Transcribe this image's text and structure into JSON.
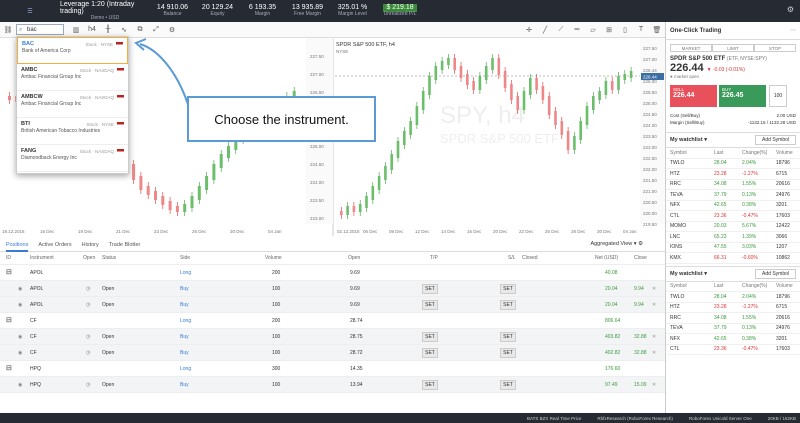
{
  "topbar": {
    "stats": [
      {
        "value": "Leverage 1:20 (Intraday trading)",
        "label": "Demo • USD"
      },
      {
        "value": "14 910.06",
        "label": "Balance"
      },
      {
        "value": "20 129.24",
        "label": "Equity"
      },
      {
        "value": "6 193.35",
        "label": "Margin"
      },
      {
        "value": "13 935.89",
        "label": "Free Margin"
      },
      {
        "value": "325.01 %",
        "label": "Margin Level"
      },
      {
        "value": "$ 219.18",
        "label": "Unrealized P/L"
      }
    ]
  },
  "search": {
    "value": "bac"
  },
  "dropdown": [
    {
      "symbol": "BAC",
      "name": "Bank of America Corp",
      "type": "Stock · NYSE"
    },
    {
      "symbol": "AMBC",
      "name": "Ambac Financial Group Inc",
      "type": "Stock · NASDAQ"
    },
    {
      "symbol": "AMBCW",
      "name": "Ambac Financial Group Inc",
      "type": "Stock · NASDAQ"
    },
    {
      "symbol": "BTI",
      "name": "British American Tobacco Industries",
      "type": "Stock · NYSE"
    },
    {
      "symbol": "FANG",
      "name": "Diamondback Energy Inc",
      "type": "Stock · NASDAQ"
    }
  ],
  "callout": {
    "text": "Choose the instrument."
  },
  "chart": {
    "left_dates": [
      "19.12.2016",
      "16 Dec",
      "19 Dec",
      "21 Dec",
      "23 Dec",
      "26 Dec",
      "30 Dec",
      "04 Jan"
    ],
    "left_prices": [
      "227.50",
      "227.00",
      "226.50",
      "226.00",
      "225.50",
      "225.00",
      "224.50",
      "224.00",
      "223.50",
      "223.00"
    ],
    "right_title": "SPDR S&P 500 ETF, h4",
    "right_sub": "NYSE",
    "right_watermark": "SPY, h4",
    "right_watermark2": "SPDR S&P 500 ETF",
    "right_dates": [
      "02.12.2016",
      "06 Dec",
      "08 Dec",
      "12 Dec",
      "14 Dec",
      "16 Dec",
      "20 Dec",
      "22 Dec",
      "26 Dec",
      "28 Dec",
      "30 Dec",
      "04 Jan"
    ],
    "right_prices": [
      "227.50",
      "227.00",
      "226.44",
      "226.00",
      "225.50",
      "225.00",
      "224.50",
      "224.00",
      "223.50",
      "223.00",
      "222.50",
      "222.00",
      "221.50",
      "221.00",
      "220.50",
      "220.00",
      "219.50"
    ],
    "current_price": "226.44"
  },
  "tabs": [
    "Positions",
    "Active Orders",
    "History",
    "Trade Blotter"
  ],
  "aggregated": "Aggregated View",
  "table": {
    "headers": [
      "ID",
      "Instrument",
      "Open",
      "Status",
      "Side",
      "Volume",
      "Open",
      "T/P",
      "S/L",
      "Closed",
      "Net (USD)",
      "Close"
    ],
    "rows": [
      {
        "kind": "parent",
        "instrument": "APOL",
        "status": "",
        "side": "Long",
        "volume": "200",
        "open": "9.69",
        "tp": "",
        "sl": "",
        "net": "40.08",
        "close": ""
      },
      {
        "kind": "child",
        "instrument": "APOL",
        "status": "Open",
        "side": "Buy",
        "volume": "100",
        "open": "9.69",
        "tp": "SET",
        "sl": "SET",
        "net": "20.04",
        "close": "9.94"
      },
      {
        "kind": "child",
        "instrument": "APOL",
        "status": "Open",
        "side": "Buy",
        "volume": "100",
        "open": "9.69",
        "tp": "SET",
        "sl": "SET",
        "net": "20.04",
        "close": "9.94"
      },
      {
        "kind": "parent",
        "instrument": "CF",
        "status": "",
        "side": "Long",
        "volume": "200",
        "open": "28.74",
        "tp": "",
        "sl": "",
        "net": "806.64",
        "close": ""
      },
      {
        "kind": "child",
        "instrument": "CF",
        "status": "Open",
        "side": "Buy",
        "volume": "100",
        "open": "28.75",
        "tp": "SET",
        "sl": "SET",
        "net": "403.82",
        "close": "32.88"
      },
      {
        "kind": "child",
        "instrument": "CF",
        "status": "Open",
        "side": "Buy",
        "volume": "100",
        "open": "28.72",
        "tp": "SET",
        "sl": "SET",
        "net": "402.82",
        "close": "32.88"
      },
      {
        "kind": "parent",
        "instrument": "HPQ",
        "status": "",
        "side": "Long",
        "volume": "300",
        "open": "14.35",
        "tp": "",
        "sl": "",
        "net": "176.60",
        "close": ""
      },
      {
        "kind": "child",
        "instrument": "HPQ",
        "status": "Open",
        "side": "Buy",
        "volume": "100",
        "open": "13.94",
        "tp": "SET",
        "sl": "SET",
        "net": "97.49",
        "close": "15.09"
      }
    ]
  },
  "right": {
    "title": "One-Click Trading",
    "order_tabs": [
      "MARKET",
      "LIMIT",
      "STOP"
    ],
    "symbol": "SPDR S&P 500 ETF",
    "symbol_meta": "(ETF, NYSE:SPY)",
    "price": "226.44",
    "price_change": "▼ -0.03 (-0.01%)",
    "market_status": "● market open",
    "sell_label": "SELL",
    "sell_price": "226.44",
    "buy_label": "BUY",
    "buy_price": "226.45",
    "qty": "100",
    "cost_label": "Cost (Sell/Buy)",
    "cost_value": "2.00 USD",
    "margin_label": "Margin (Sell/Buy)",
    "margin_value": "-1132.15 / 1132.28 USD",
    "watchlist_title": "My watchlist",
    "add_symbol": "Add Symbol",
    "wl_headers": [
      "Symbol",
      "Last",
      "Change(%)",
      "Volume"
    ],
    "watchlist": [
      {
        "s": "TWLO",
        "last": "28.04",
        "chg": "2.04%",
        "vol": "18796",
        "up": true
      },
      {
        "s": "HTZ",
        "last": "23.28",
        "chg": "-1.27%",
        "vol": "6715",
        "up": false
      },
      {
        "s": "RRC",
        "last": "34.08",
        "chg": "1.55%",
        "vol": "20616",
        "up": true
      },
      {
        "s": "TEVA",
        "last": "37.79",
        "chg": "0.13%",
        "vol": "24976",
        "up": true
      },
      {
        "s": "NFX",
        "last": "42.65",
        "chg": "0.38%",
        "vol": "3201",
        "up": true
      },
      {
        "s": "CTL",
        "last": "23.36",
        "chg": "-0.47%",
        "vol": "17603",
        "up": false
      },
      {
        "s": "MOMO",
        "last": "20.03",
        "chg": "5.67%",
        "vol": "12422",
        "up": true
      },
      {
        "s": "LNC",
        "last": "65.23",
        "chg": "1.39%",
        "vol": "3066",
        "up": true
      },
      {
        "s": "IONS",
        "last": "47.55",
        "chg": "3.03%",
        "vol": "1207",
        "up": true
      },
      {
        "s": "KMX",
        "last": "66.31",
        "chg": "-0.60%",
        "vol": "10862",
        "up": false
      }
    ],
    "watchlist2": [
      {
        "s": "TWLO",
        "last": "28.04",
        "chg": "2.04%",
        "vol": "18796",
        "up": true
      },
      {
        "s": "HTZ",
        "last": "23.28",
        "chg": "-1.27%",
        "vol": "6715",
        "up": false
      },
      {
        "s": "RRC",
        "last": "34.08",
        "chg": "1.55%",
        "vol": "20616",
        "up": true
      },
      {
        "s": "TEVA",
        "last": "37.79",
        "chg": "0.13%",
        "vol": "24976",
        "up": true
      },
      {
        "s": "NFX",
        "last": "42.65",
        "chg": "0.38%",
        "vol": "3201",
        "up": true
      },
      {
        "s": "CTL",
        "last": "23.36",
        "chg": "-0.47%",
        "vol": "17603",
        "up": false
      }
    ]
  },
  "status": {
    "feed": "BATS BZX Real Time Price",
    "research": "RbfxResearch (RoboForex Research)",
    "server": "RoboForex Unicold Server One",
    "speed": "20KB / 152KB"
  }
}
